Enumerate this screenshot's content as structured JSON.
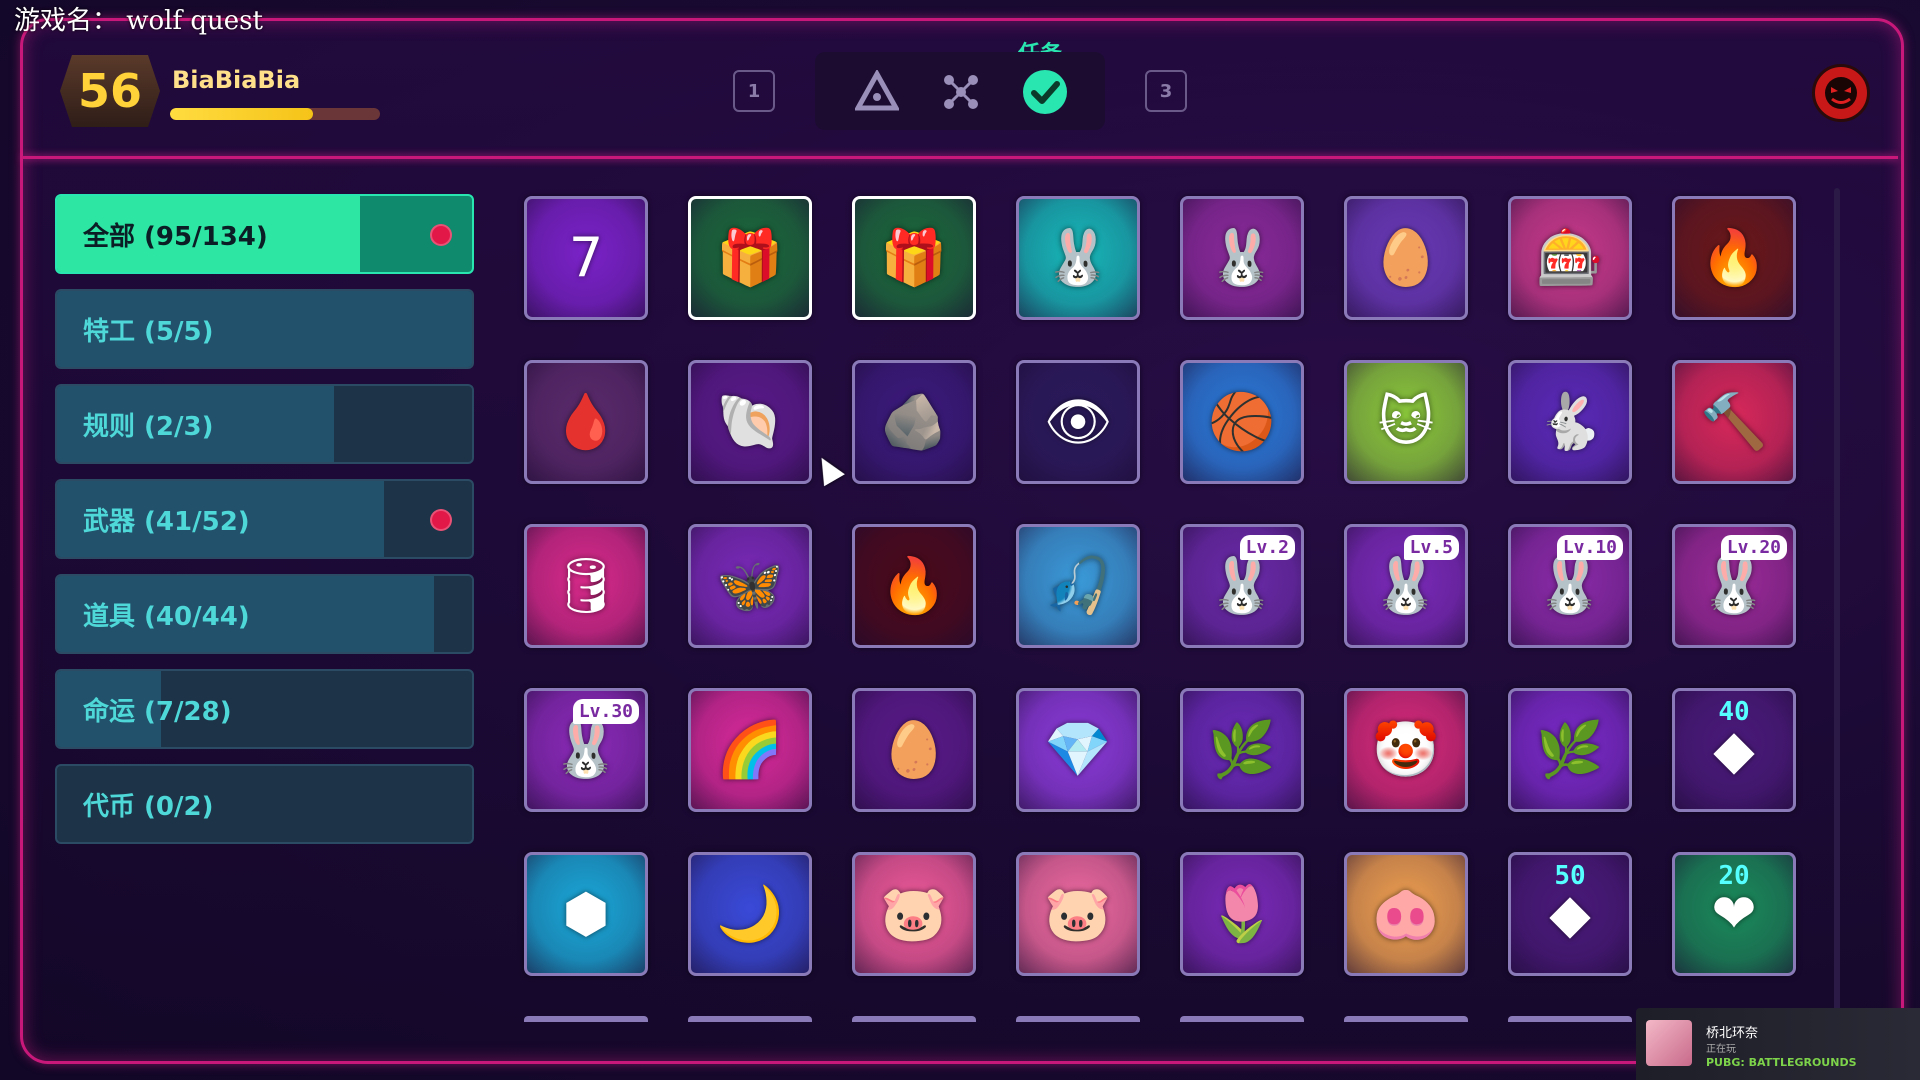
{
  "watermark": "游戏名： wolf quest",
  "player": {
    "level": "56",
    "name": "BiaBiaBia",
    "xp_fraction": 0.68
  },
  "tabbar": {
    "key_left": "1",
    "key_right": "3",
    "active_label": "任务",
    "tabs": [
      {
        "icon": "warning-triangle-icon",
        "active": false
      },
      {
        "icon": "nodes-icon",
        "active": false
      },
      {
        "icon": "check-badge-icon",
        "active": true
      }
    ]
  },
  "top_right_icon": "demon-face-icon",
  "categories": [
    {
      "label": "全部 (95/134)",
      "progress": 0.709,
      "active": true,
      "dot": true
    },
    {
      "label": "特工 (5/5)",
      "progress": 1.0,
      "active": false,
      "dot": false
    },
    {
      "label": "规则 (2/3)",
      "progress": 0.667,
      "active": false,
      "dot": false
    },
    {
      "label": "武器 (41/52)",
      "progress": 0.788,
      "active": false,
      "dot": true
    },
    {
      "label": "道具 (40/44)",
      "progress": 0.909,
      "active": false,
      "dot": false
    },
    {
      "label": "命运 (7/28)",
      "progress": 0.25,
      "active": false,
      "dot": false
    },
    {
      "label": "代币 (0/2)",
      "progress": 0.0,
      "active": false,
      "dot": false
    }
  ],
  "tiles": [
    {
      "icon": "number-seven-icon",
      "glyph": "7",
      "bg": "#7a22c8"
    },
    {
      "icon": "gift-box-icon",
      "glyph": "🎁",
      "bg": "#1a6a3a",
      "selected": true
    },
    {
      "icon": "gift-box-20-icon",
      "glyph": "🎁",
      "bg": "#1a6a3a",
      "selected": true
    },
    {
      "icon": "bunny-tier-one-icon",
      "glyph": "🐰",
      "bg": "#16b8b8"
    },
    {
      "icon": "bunny-tier-five-icon",
      "glyph": "🐰",
      "bg": "#8a2a9a"
    },
    {
      "icon": "striped-egg-icon",
      "glyph": "🥚",
      "bg": "#6a3ab8"
    },
    {
      "icon": "slot-machine-icon",
      "glyph": "🎰",
      "bg": "#c83a8a"
    },
    {
      "icon": "fire-drop-icon",
      "glyph": "🔥",
      "bg": "#6a1818"
    },
    {
      "icon": "blood-drop-icon",
      "glyph": "🩸",
      "bg": "#5a2a6a"
    },
    {
      "icon": "grey-cap-creature-icon",
      "glyph": "🐚",
      "bg": "#5a1a8a"
    },
    {
      "icon": "rock-creature-icon",
      "glyph": "🪨",
      "bg": "#3a1a7a"
    },
    {
      "icon": "eye-creature-icon",
      "glyph": "👁",
      "bg": "#2a1a5a"
    },
    {
      "icon": "basketball-hoop-icon",
      "glyph": "🏀",
      "bg": "#2a7ad8"
    },
    {
      "icon": "green-cat-icon",
      "glyph": "🐱",
      "bg": "#8ac83a"
    },
    {
      "icon": "jumping-bunny-icon",
      "glyph": "🐇",
      "bg": "#5a2ab8"
    },
    {
      "icon": "red-mallet-icon",
      "glyph": "🔨",
      "bg": "#d8285a"
    },
    {
      "icon": "wooden-barrel-icon",
      "glyph": "🛢",
      "bg": "#d82a8a"
    },
    {
      "icon": "butterfly-blade-icon",
      "glyph": "🦋",
      "bg": "#7a2ab8"
    },
    {
      "icon": "red-flame-drop-icon",
      "glyph": "🔥",
      "bg": "#4a0a1a"
    },
    {
      "icon": "fishing-bunny-icon",
      "glyph": "🎣",
      "bg": "#3a9ad8"
    },
    {
      "icon": "bunny-level-2-icon",
      "glyph": "🐰",
      "bg": "#6a2aa8",
      "lv": "Lv.2"
    },
    {
      "icon": "bunny-level-5-icon",
      "glyph": "🐰",
      "bg": "#7a2ab8",
      "lv": "Lv.5"
    },
    {
      "icon": "bunny-level-10-icon",
      "glyph": "🐰",
      "bg": "#8a2aa8",
      "lv": "Lv.10"
    },
    {
      "icon": "bunny-level-20-icon",
      "glyph": "🐰",
      "bg": "#9a2a98",
      "lv": "Lv.20"
    },
    {
      "icon": "bunny-level-30-icon",
      "glyph": "🐰",
      "bg": "#8a2ab8",
      "lv": "Lv.30"
    },
    {
      "icon": "rainbow-slime-icon",
      "glyph": "🌈",
      "bg": "#d82a9a"
    },
    {
      "icon": "easter-eggs-icon",
      "glyph": "🥚",
      "bg": "#5a1a8a"
    },
    {
      "icon": "purple-crystals-icon",
      "glyph": "💎",
      "bg": "#8a3ad8"
    },
    {
      "icon": "creature-bouquet-icon",
      "glyph": "🌿",
      "bg": "#6a2ab8"
    },
    {
      "icon": "clown-box-icon",
      "glyph": "🤡",
      "bg": "#d82a7a"
    },
    {
      "icon": "creature-bouquet-2-icon",
      "glyph": "🌿",
      "bg": "#7a2ac8"
    },
    {
      "icon": "emblem-40-icon",
      "glyph": "◆",
      "bg": "#4a1a7a",
      "num": "40"
    },
    {
      "icon": "blue-hexagons-icon",
      "glyph": "⬢",
      "bg": "#1aa8d8"
    },
    {
      "icon": "speeding-anvil-icon",
      "glyph": "🌙",
      "bg": "#3a4ad8"
    },
    {
      "icon": "pink-blob-icon",
      "glyph": "🐷",
      "bg": "#f05a9a"
    },
    {
      "icon": "pink-blob-group-icon",
      "glyph": "🐷",
      "bg": "#f06aa0"
    },
    {
      "icon": "pink-tulip-icon",
      "glyph": "🌷",
      "bg": "#7a2ab8"
    },
    {
      "icon": "pink-pig-face-icon",
      "glyph": "🐽",
      "bg": "#f0a050"
    },
    {
      "icon": "emblem-50-icon",
      "glyph": "◆",
      "bg": "#4a1a7a",
      "num": "50"
    },
    {
      "icon": "heart-emblem-20-icon",
      "glyph": "❤",
      "bg": "#1a8a5a",
      "num": "20"
    }
  ],
  "notification": {
    "name": "桥北环奈",
    "status": "正在玩",
    "game": "PUBG: BATTLEGROUNDS"
  }
}
